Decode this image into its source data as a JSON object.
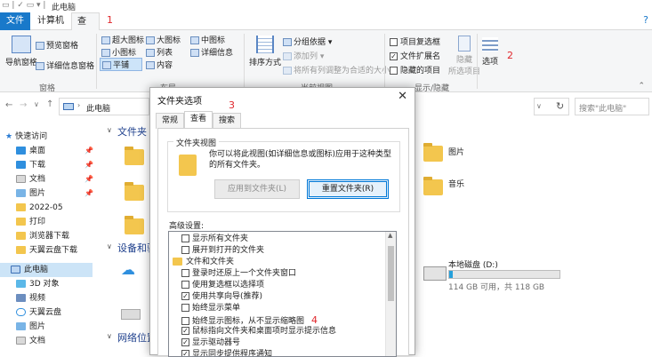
{
  "window": {
    "title": "此电脑"
  },
  "tabs": {
    "file": "文件",
    "computer": "计算机",
    "view": "查看",
    "marker1": "1",
    "marker2": "2",
    "marker3": "3",
    "marker4": "4"
  },
  "ribbon": {
    "nav_pane": "导航窗格",
    "preview_pane": "预览窗格",
    "details_pane": "详细信息窗格",
    "group_panes": "窗格",
    "layout": [
      "超大图标",
      "大图标",
      "中图标",
      "小图标",
      "列表",
      "详细信息",
      "平铺",
      "内容"
    ],
    "group_layout": "布局",
    "sort": "排序方式",
    "group_by": "分组依据",
    "add_column": "添加列",
    "fit_columns": "将所有列调整为合适的大小",
    "group_current": "当前视图",
    "item_checkbox": "项目复选框",
    "ext": "文件扩展名",
    "hidden_items": "隐藏的项目",
    "hide": "隐藏",
    "hide_selected": "所选项目",
    "group_showhide": "显示/隐藏",
    "options": "选项"
  },
  "address": {
    "path": "此电脑",
    "search_placeholder": "搜索\"此电脑\""
  },
  "nav": {
    "quick": "快速访问",
    "items": [
      "桌面",
      "下载",
      "文档",
      "图片",
      "2022-05",
      "打印",
      "浏览器下载",
      "天翼云盘下载"
    ],
    "thispc": "此电脑",
    "pc_items": [
      "3D 对象",
      "视频",
      "天翼云盘",
      "图片",
      "文档"
    ]
  },
  "content": {
    "folders_title": "文件夹 (7)",
    "devices_title": "设备和驱动器",
    "network_title": "网络位置",
    "pictures": "图片",
    "music": "音乐",
    "drive_name": "本地磁盘 (D:)",
    "drive_free": "114 GB 可用，共 118 GB",
    "drive_fill_fraction": 0.03
  },
  "dialog": {
    "title": "文件夹选项",
    "tabs": [
      "常规",
      "查看",
      "搜索"
    ],
    "folder_views_legend": "文件夹视图",
    "folder_views_desc": "你可以将此视图(如详细信息或图标)应用于这种类型的所有文件夹。",
    "apply_btn": "应用到文件夹(L)",
    "reset_btn": "重置文件夹(R)",
    "advanced_label": "高级设置:",
    "list": [
      {
        "text": "显示所有文件夹",
        "checked": false,
        "indent": 1
      },
      {
        "text": "展开到打开的文件夹",
        "checked": false,
        "indent": 1
      },
      {
        "text": "文件和文件夹",
        "checked": null,
        "indent": 0
      },
      {
        "text": "登录时还原上一个文件夹窗口",
        "checked": false,
        "indent": 1
      },
      {
        "text": "使用复选框以选择项",
        "checked": false,
        "indent": 1
      },
      {
        "text": "使用共享向导(推荐)",
        "checked": true,
        "indent": 1
      },
      {
        "text": "始终显示菜单",
        "checked": false,
        "indent": 1
      },
      {
        "text": "始终显示图标，从不显示缩略图",
        "checked": false,
        "indent": 1
      },
      {
        "text": "鼠标指向文件夹和桌面项时显示提示信息",
        "checked": true,
        "indent": 1
      },
      {
        "text": "显示驱动器号",
        "checked": true,
        "indent": 1
      },
      {
        "text": "显示同步提供程序通知",
        "checked": true,
        "indent": 1
      }
    ]
  }
}
